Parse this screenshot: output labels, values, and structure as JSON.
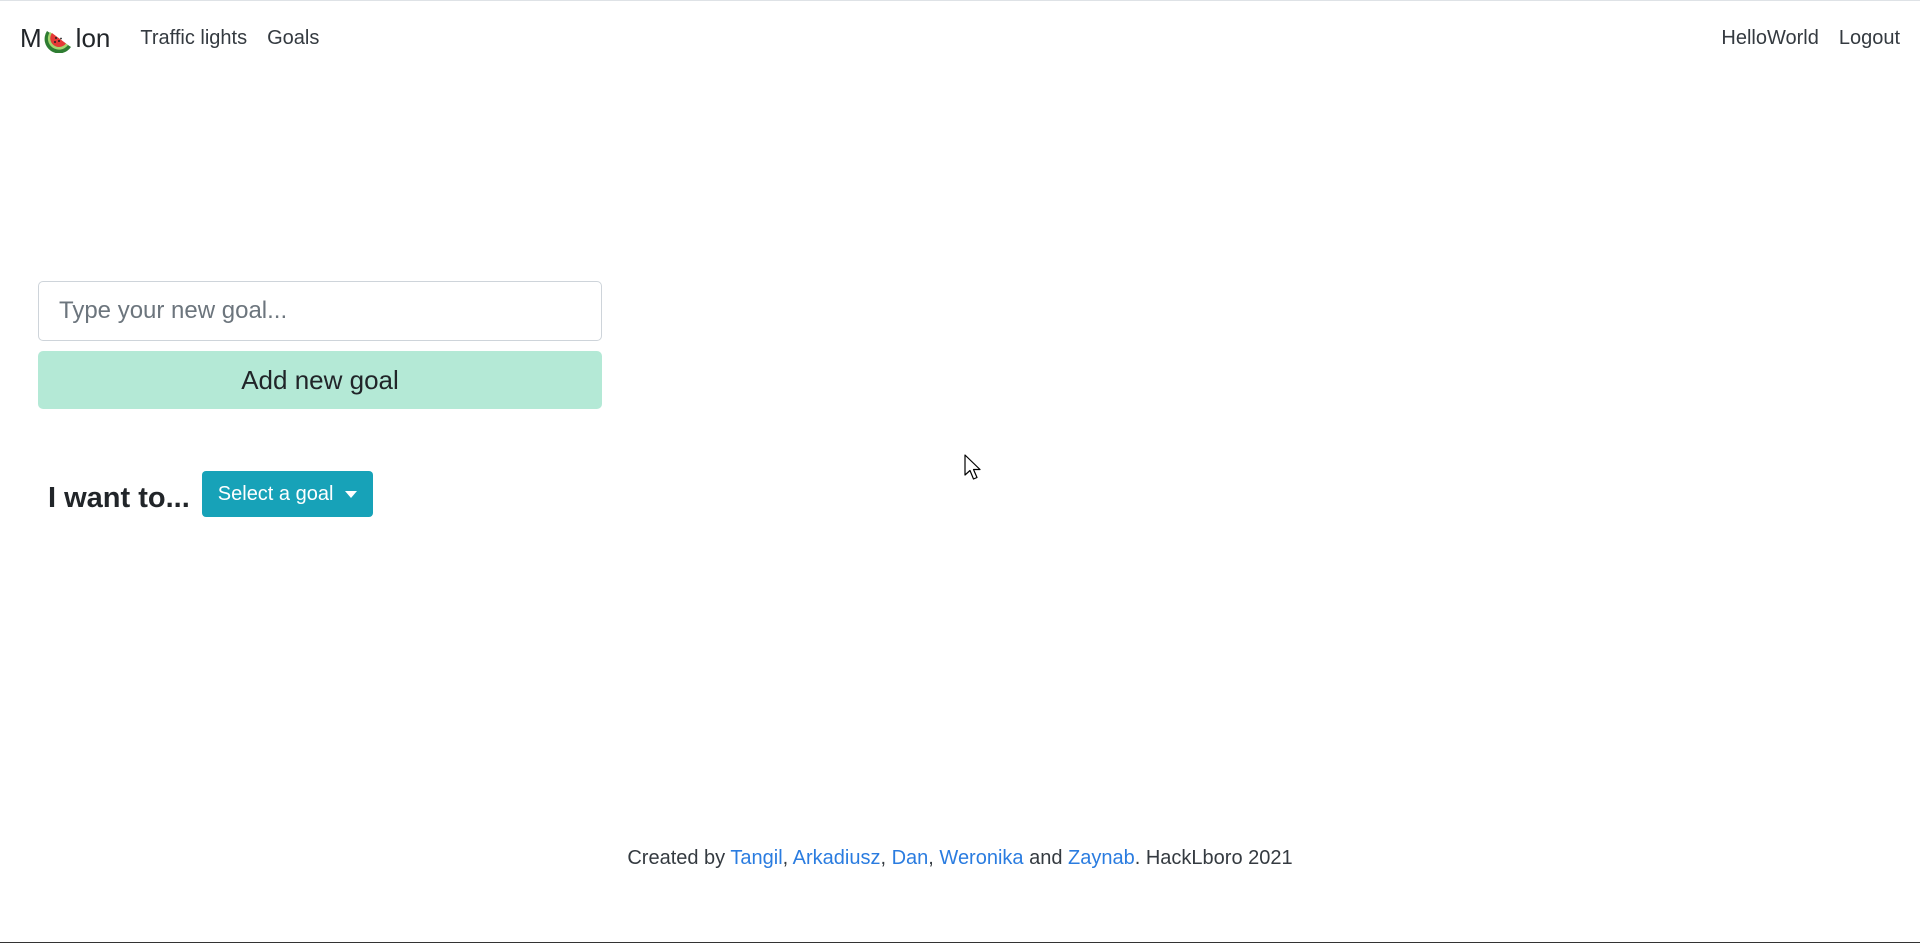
{
  "navbar": {
    "brand_prefix": "M",
    "brand_suffix": "lon",
    "brand_icon": "watermelon-icon",
    "links": [
      "Traffic lights",
      "Goals"
    ],
    "right_links": [
      "HelloWorld",
      "Logout"
    ]
  },
  "goal_form": {
    "input_value": "",
    "input_placeholder": "Type your new goal...",
    "add_button_label": "Add new goal"
  },
  "want": {
    "label": "I want to...",
    "select_label": "Select a goal"
  },
  "footer": {
    "prefix": "Created by ",
    "authors": [
      "Tangil",
      "Arkadiusz",
      "Dan",
      "Weronika",
      "Zaynab"
    ],
    "sep_comma": ", ",
    "sep_and": " and ",
    "suffix": ". HackLboro 2021"
  },
  "colors": {
    "accent_button": "#17a2b8",
    "add_button": "#b4e9d6",
    "link": "#2a7ce0"
  }
}
